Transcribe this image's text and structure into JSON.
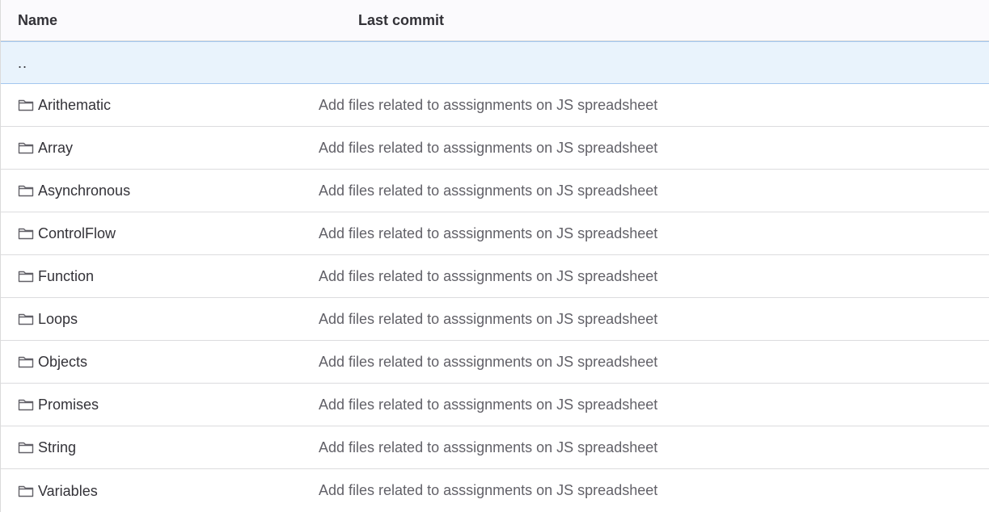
{
  "table": {
    "headers": {
      "name": "Name",
      "last_commit": "Last commit"
    },
    "parent_link": "..",
    "rows": [
      {
        "name": "Arithematic",
        "commit": "Add files related to asssignments on JS spreadsheet",
        "icon": "folder-icon"
      },
      {
        "name": "Array",
        "commit": "Add files related to asssignments on JS spreadsheet",
        "icon": "folder-icon"
      },
      {
        "name": "Asynchronous",
        "commit": "Add files related to asssignments on JS spreadsheet",
        "icon": "folder-icon"
      },
      {
        "name": "ControlFlow",
        "commit": "Add files related to asssignments on JS spreadsheet",
        "icon": "folder-icon"
      },
      {
        "name": "Function",
        "commit": "Add files related to asssignments on JS spreadsheet",
        "icon": "folder-icon"
      },
      {
        "name": "Loops",
        "commit": "Add files related to asssignments on JS spreadsheet",
        "icon": "folder-icon"
      },
      {
        "name": "Objects",
        "commit": "Add files related to asssignments on JS spreadsheet",
        "icon": "folder-icon"
      },
      {
        "name": "Promises",
        "commit": "Add files related to asssignments on JS spreadsheet",
        "icon": "folder-icon"
      },
      {
        "name": "String",
        "commit": "Add files related to asssignments on JS spreadsheet",
        "icon": "folder-icon"
      },
      {
        "name": "Variables",
        "commit": "Add files related to asssignments on JS spreadsheet",
        "icon": "folder-icon"
      }
    ]
  },
  "colors": {
    "header_bg": "#fbfafd",
    "parent_row_bg": "#e9f3fc",
    "text_primary": "#333238",
    "text_secondary": "#626168",
    "border": "#dcdcde"
  }
}
